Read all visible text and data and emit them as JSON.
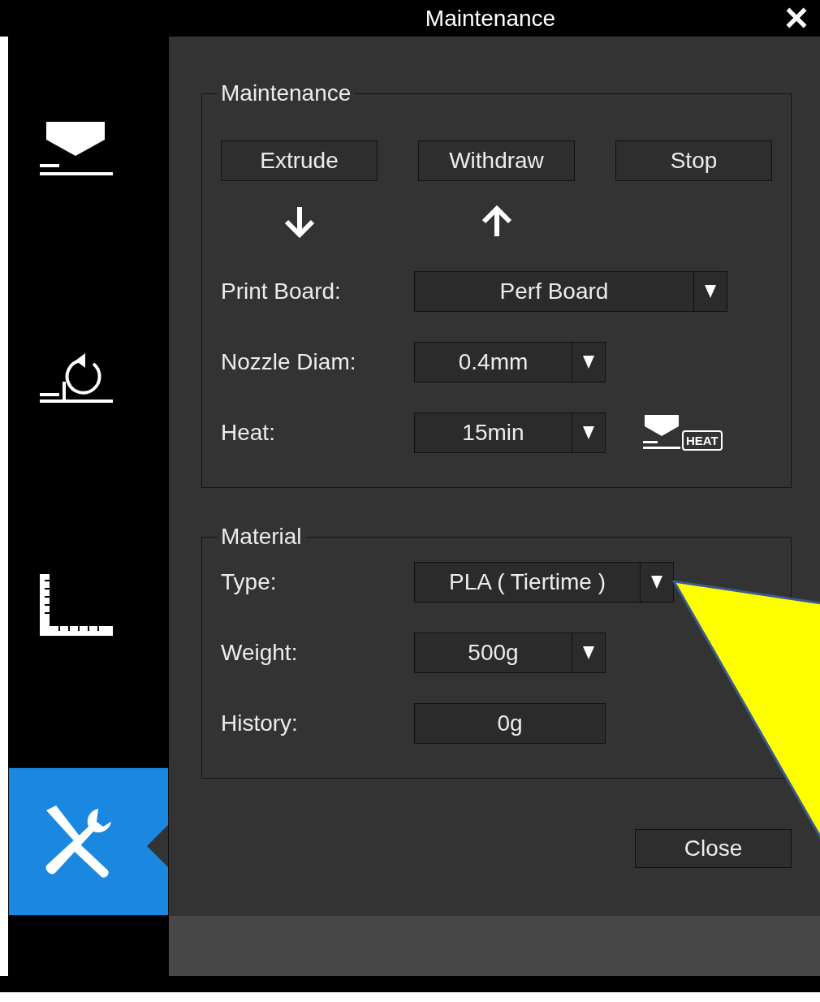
{
  "window": {
    "title": "Maintenance"
  },
  "sidebar": {
    "items": [
      {
        "kind": "nozzle",
        "selected": false
      },
      {
        "kind": "reset",
        "selected": false
      },
      {
        "kind": "ruler",
        "selected": false
      },
      {
        "kind": "tools",
        "selected": true
      }
    ]
  },
  "maintenance": {
    "legend": "Maintenance",
    "buttons": [
      {
        "label": "Extrude",
        "kind": "extrude"
      },
      {
        "label": "Withdraw",
        "kind": "withdraw"
      },
      {
        "label": "Stop",
        "kind": "stop"
      }
    ],
    "rows": [
      {
        "label": "Print Board:",
        "value": "Perf Board",
        "kind": "dropdown"
      },
      {
        "label": "Nozzle Diam:",
        "value": "0.4mm",
        "kind": "dropdown"
      },
      {
        "label": "Heat:",
        "value": "15min",
        "kind": "dropdown",
        "badge": "HEAT"
      }
    ]
  },
  "material": {
    "legend": "Material",
    "rows": [
      {
        "label": "Type:",
        "value": "PLA ( Tiertime )",
        "kind": "dropdown"
      },
      {
        "label": "Weight:",
        "value": "500g",
        "kind": "dropdown"
      },
      {
        "label": "History:",
        "value": "0g",
        "kind": "field"
      }
    ]
  },
  "close_button": "Close",
  "callout": {
    "kind": "arrow"
  }
}
